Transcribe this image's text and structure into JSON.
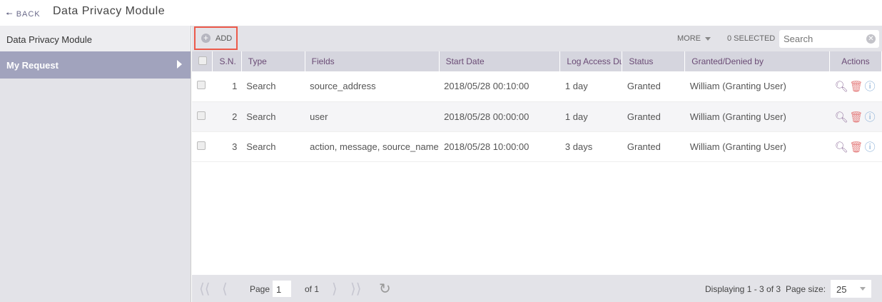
{
  "header": {
    "back": "BACK",
    "title": "Data Privacy Module"
  },
  "sidebar": {
    "heading": "Data Privacy Module",
    "items": [
      {
        "label": "My Request"
      }
    ]
  },
  "toolbar": {
    "add": "ADD",
    "more": "MORE",
    "selected": "0 SELECTED",
    "search_placeholder": "Search"
  },
  "table": {
    "columns": [
      "S.N.",
      "Type",
      "Fields",
      "Start Date",
      "Log Access Dur",
      "Status",
      "Granted/Denied by",
      "Actions"
    ],
    "rows": [
      {
        "sn": "1",
        "type": "Search",
        "fields": "source_address",
        "start": "2018/05/28 00:10:00",
        "duration": "1 day",
        "status": "Granted",
        "by": "William (Granting User)"
      },
      {
        "sn": "2",
        "type": "Search",
        "fields": "user",
        "start": "2018/05/28 00:00:00",
        "duration": "1 day",
        "status": "Granted",
        "by": "William (Granting User)"
      },
      {
        "sn": "3",
        "type": "Search",
        "fields": "action, message, source_name",
        "start": "2018/05/28 10:00:00",
        "duration": "3 days",
        "status": "Granted",
        "by": "William (Granting User)"
      }
    ]
  },
  "footer": {
    "page_label": "Page",
    "page": "1",
    "of": "of 1",
    "displaying": "Displaying 1 - 3 of 3",
    "page_size_label": "Page size:",
    "page_size": "25"
  },
  "colors": {
    "sidebar_active": "#a1a3bd",
    "highlight": "#ec5a4a",
    "view_icon": "#9b7fa6",
    "delete_icon": "#e58080",
    "info_icon": "#7fa9d4"
  }
}
